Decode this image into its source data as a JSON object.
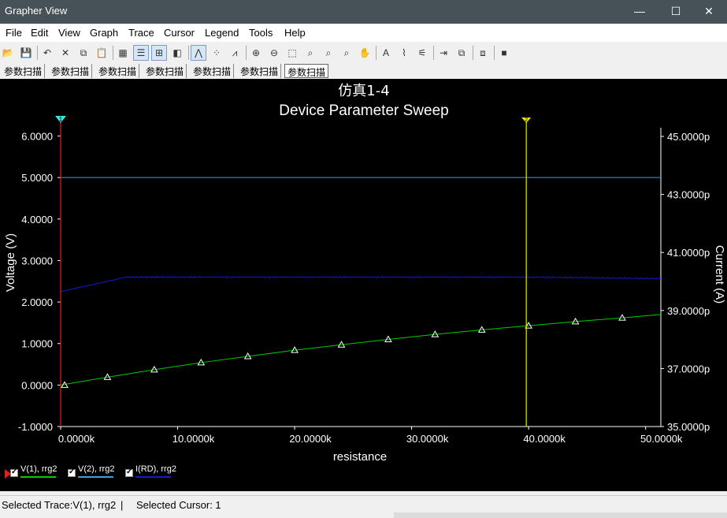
{
  "window": {
    "title": "Grapher View",
    "minimize": "—",
    "maximize": "☐",
    "close": "✕"
  },
  "menu": [
    "File",
    "Edit",
    "View",
    "Graph",
    "Trace",
    "Cursor",
    "Legend",
    "Tools",
    "Help"
  ],
  "toolbar": {
    "buttons": [
      {
        "name": "open-icon",
        "glyph": "📂"
      },
      {
        "name": "save-icon",
        "glyph": "💾"
      },
      {
        "name": "undo-icon",
        "glyph": "↶"
      },
      {
        "name": "cut-icon",
        "glyph": "✕"
      },
      {
        "name": "copy-icon",
        "glyph": "⧉"
      },
      {
        "name": "paste-icon",
        "glyph": "📋"
      },
      {
        "name": "grid-icon",
        "glyph": "▦"
      },
      {
        "name": "legend-toggle-icon",
        "glyph": "☰",
        "active": true
      },
      {
        "name": "cursor-toggle-icon",
        "glyph": "⊞",
        "active": true
      },
      {
        "name": "overlay-icon",
        "glyph": "◧"
      },
      {
        "name": "show-lines-icon",
        "glyph": "⋀",
        "active": true
      },
      {
        "name": "show-points-icon",
        "glyph": "⁘"
      },
      {
        "name": "lines-points-icon",
        "glyph": "⩘"
      },
      {
        "name": "zoom-in-icon",
        "glyph": "⊕"
      },
      {
        "name": "zoom-out-icon",
        "glyph": "⊖"
      },
      {
        "name": "zoom-area-icon",
        "glyph": "⬚"
      },
      {
        "name": "zoom-x-icon",
        "glyph": "⌕"
      },
      {
        "name": "zoom-y-icon",
        "glyph": "⌕"
      },
      {
        "name": "zoom-full-icon",
        "glyph": "⌕"
      },
      {
        "name": "pan-icon",
        "glyph": "✋"
      },
      {
        "name": "text-icon",
        "glyph": "A"
      },
      {
        "name": "label-icon",
        "glyph": "⌇"
      },
      {
        "name": "trace-props-icon",
        "glyph": "⚟"
      },
      {
        "name": "export-icon",
        "glyph": "⇥"
      },
      {
        "name": "overlay-traces-icon",
        "glyph": "⧉"
      },
      {
        "name": "merge-icon",
        "glyph": "⧈"
      },
      {
        "name": "stop-icon",
        "glyph": "■"
      }
    ]
  },
  "tabs": [
    "参数扫描",
    "参数扫描",
    "参数扫描",
    "参数扫描",
    "参数扫描",
    "参数扫描",
    "参数扫描"
  ],
  "selected_tab": 6,
  "plot": {
    "title_line1": "仿真1-4",
    "title_line2": "Device Parameter Sweep",
    "xlabel": "resistance",
    "ylabel_left": "Voltage (V)",
    "ylabel_right": "Current (A)",
    "x_ticks": [
      "0.0000k",
      "10.0000k",
      "20.0000k",
      "30.0000k",
      "40.0000k",
      "50.0000k"
    ],
    "y_left_ticks": [
      "6.0000",
      "5.0000",
      "4.0000",
      "3.0000",
      "2.0000",
      "1.0000",
      "0.0000",
      "-1.0000"
    ],
    "y_right_ticks": [
      "45.0000p",
      "43.0000p",
      "41.0000p",
      "39.0000p",
      "37.0000p",
      "35.0000p"
    ],
    "cursor1_label": "1",
    "cursor2_label": "2",
    "colors": {
      "background": "#000000",
      "axes": "#ffffff",
      "v1": "#00cc00",
      "v2": "#3aa0e0",
      "ird": "#1818d0",
      "cursor1": "#e02020",
      "cursor2": "#e8e800"
    }
  },
  "chart_data": {
    "type": "line",
    "title": "仿真1-4 Device Parameter Sweep",
    "xlabel": "resistance",
    "ylabel": "Voltage (V)",
    "y2label": "Current (A)",
    "xlim": [
      0,
      51300
    ],
    "ylim": [
      -1,
      6.2
    ],
    "y2lim": [
      3.5e-11,
      4.53e-11
    ],
    "series": [
      {
        "name": "V(1), rrg2",
        "axis": "left",
        "marker": "triangle",
        "x": [
          0,
          4000,
          8000,
          12000,
          16000,
          20000,
          24000,
          28000,
          32000,
          36000,
          40000,
          44000,
          48000,
          51300
        ],
        "y": [
          0.0,
          0.19,
          0.37,
          0.54,
          0.69,
          0.84,
          0.97,
          1.1,
          1.22,
          1.33,
          1.43,
          1.53,
          1.62,
          1.7
        ]
      },
      {
        "name": "V(2), rrg2",
        "axis": "left",
        "x": [
          0,
          51300
        ],
        "y": [
          5.0,
          5.0
        ]
      },
      {
        "name": "I(RD), rrg2",
        "axis": "right",
        "x": [
          0,
          5600,
          10000,
          20000,
          30000,
          40000,
          51300
        ],
        "y": [
          3.965e-11,
          4.015e-11,
          4.015e-11,
          4.015e-11,
          4.015e-11,
          4.015e-11,
          4.01e-11
        ]
      }
    ],
    "cursors": [
      {
        "label": "1",
        "x": 0
      },
      {
        "label": "2",
        "x": 39800
      }
    ]
  },
  "legend": [
    {
      "label": "V(1), rrg2",
      "color": "#00cc00"
    },
    {
      "label": "V(2), rrg2",
      "color": "#3aa0e0"
    },
    {
      "label": "I(RD), rrg2",
      "color": "#1818d0"
    }
  ],
  "status": {
    "selected_trace": "Selected Trace:V(1), rrg2",
    "separator": "|",
    "selected_cursor": "Selected Cursor: 1"
  }
}
